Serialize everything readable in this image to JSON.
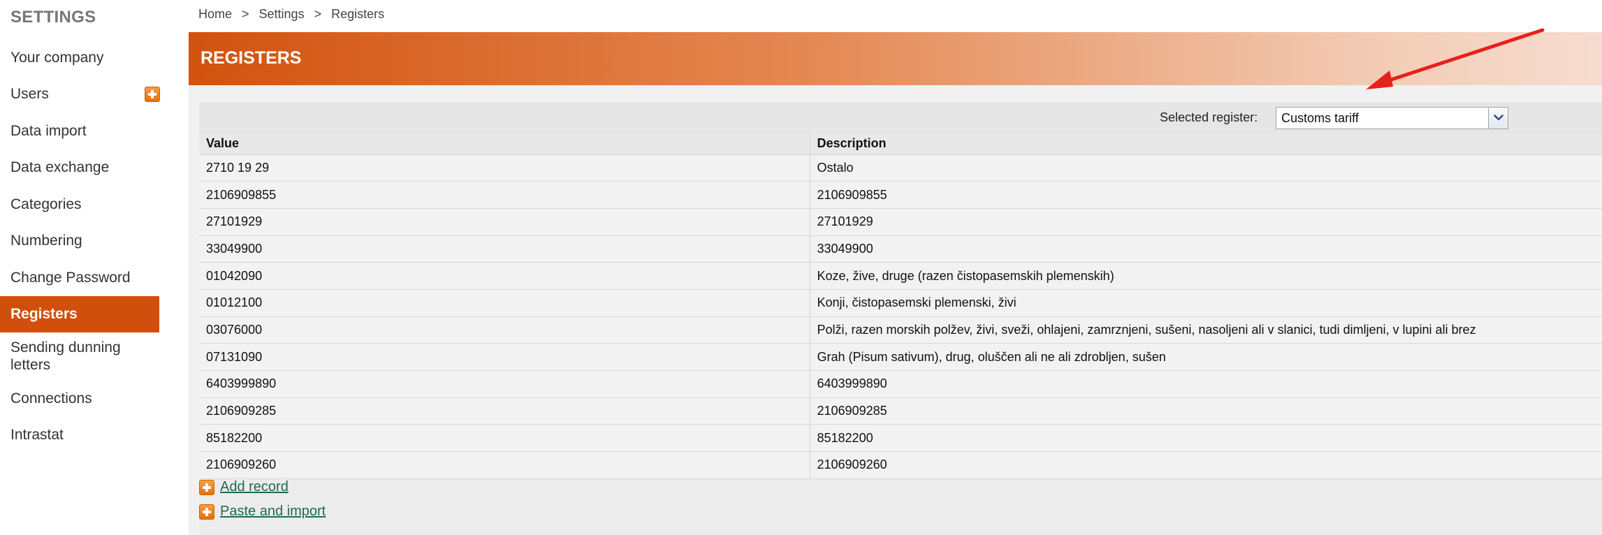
{
  "sidebar": {
    "title": "SETTINGS",
    "items": [
      {
        "label": "Your company",
        "type": "single"
      },
      {
        "label": "Users",
        "type": "single",
        "has_add": true
      },
      {
        "label": "Data import",
        "type": "single"
      },
      {
        "label": "Data exchange",
        "type": "single"
      },
      {
        "label": "Categories",
        "type": "single"
      },
      {
        "label": "Numbering",
        "type": "single"
      },
      {
        "label": "Change Password",
        "type": "single"
      },
      {
        "label": "Registers",
        "type": "single",
        "active": true
      },
      {
        "label": "Sending dunning letters",
        "type": "double"
      },
      {
        "label": "Connections",
        "type": "single"
      },
      {
        "label": "Intrastat",
        "type": "single"
      }
    ]
  },
  "breadcrumb": {
    "items": [
      "Home",
      "Settings",
      "Registers"
    ],
    "separator": ">"
  },
  "header": {
    "title": "REGISTERS"
  },
  "toolbar": {
    "selected_register_label": "Selected register:",
    "selected_register_value": "Customs tariff"
  },
  "table": {
    "columns": [
      "Value",
      "Description"
    ],
    "rows": [
      [
        "2710 19 29",
        "Ostalo"
      ],
      [
        "2106909855",
        "2106909855"
      ],
      [
        "27101929",
        "27101929"
      ],
      [
        "33049900",
        "33049900"
      ],
      [
        "01042090",
        "Koze, žive, druge (razen čistopasemskih plemenskih)"
      ],
      [
        "01012100",
        "Konji, čistopasemski plemenski, živi"
      ],
      [
        "03076000",
        "Polži, razen morskih polžev, živi, sveži, ohlajeni, zamrznjeni, sušeni, nasoljeni ali v slanici, tudi dimljeni, v lupini ali brez"
      ],
      [
        "07131090",
        "Grah (Pisum sativum), drug, oluščen ali ne ali zdrobljen, sušen"
      ],
      [
        "6403999890",
        "6403999890"
      ],
      [
        "2106909285",
        "2106909285"
      ],
      [
        "85182200",
        "85182200"
      ],
      [
        "2106909260",
        "2106909260"
      ]
    ]
  },
  "actions": {
    "add_record": "Add record",
    "paste_import": "Paste and import"
  },
  "colors": {
    "accent": "#d14f0c",
    "annotation_arrow": "#e8201a",
    "link": "#1f6a50"
  }
}
